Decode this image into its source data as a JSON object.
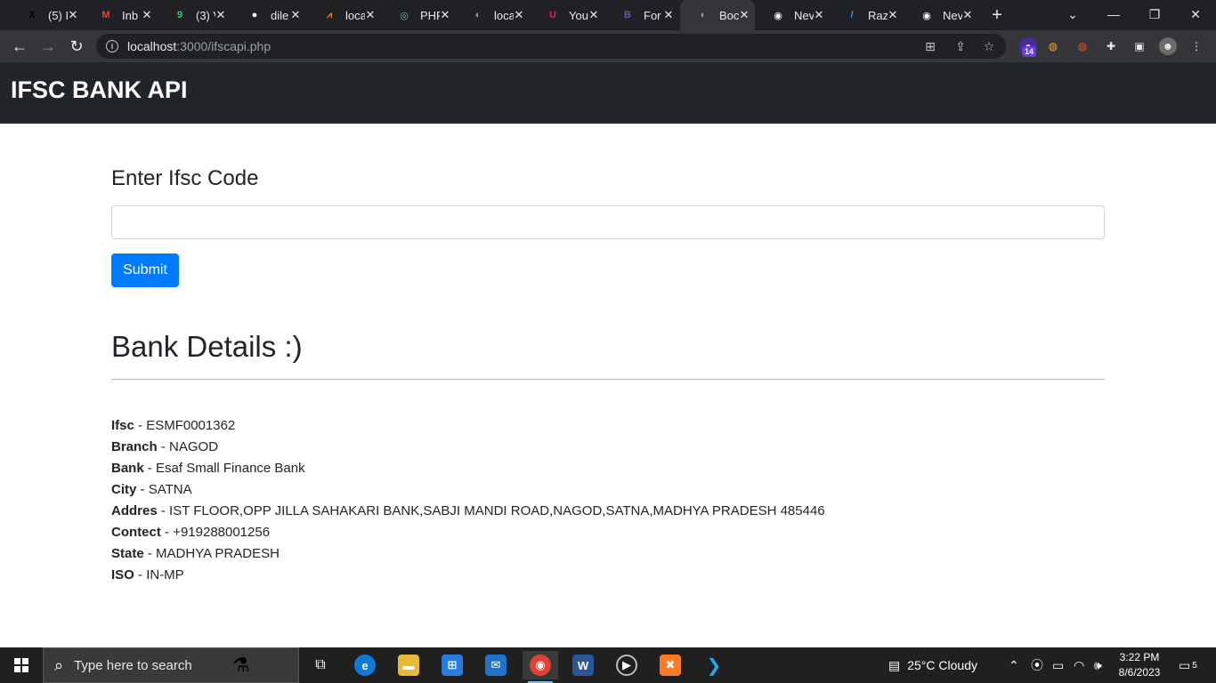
{
  "browser": {
    "tabs": [
      {
        "title": "(5) I",
        "icon": "x-icon",
        "icon_text": "X",
        "icon_color": "#000000"
      },
      {
        "title": "Inb",
        "icon": "gmail-icon",
        "icon_text": "M",
        "icon_color": "#ea4335"
      },
      {
        "title": "(3) V",
        "icon": "whatsapp-icon",
        "icon_text": "9",
        "icon_color": "#25d366"
      },
      {
        "title": "dile",
        "icon": "github-icon",
        "icon_text": "●",
        "icon_color": "#ffffff"
      },
      {
        "title": "loca",
        "icon": "xampp-icon",
        "icon_text": "⩘",
        "icon_color": "#fb7a24"
      },
      {
        "title": "PHF",
        "icon": "chatgpt-icon",
        "icon_text": "◎",
        "icon_color": "#74aa9c"
      },
      {
        "title": "loca",
        "icon": "globe-icon",
        "icon_text": "◐",
        "icon_color": "#9aa0a6"
      },
      {
        "title": "You",
        "icon": "udemy-icon",
        "icon_text": "U",
        "icon_color": "#ec1c5e"
      },
      {
        "title": "For",
        "icon": "bootstrap-icon",
        "icon_text": "B",
        "icon_color": "#7952b3"
      },
      {
        "title": "Boc",
        "icon": "globe-icon",
        "icon_text": "◐",
        "icon_color": "#9aa0a6"
      },
      {
        "title": "Nev",
        "icon": "chrome-icon",
        "icon_text": "◉",
        "icon_color": "#ffffff"
      },
      {
        "title": "Raz",
        "icon": "razorpay-icon",
        "icon_text": "/",
        "icon_color": "#3395ff"
      },
      {
        "title": "Nev",
        "icon": "chrome-icon",
        "icon_text": "◉",
        "icon_color": "#ffffff"
      }
    ],
    "active_tab": 9,
    "url_host": "localhost",
    "url_rest": ":3000/ifscapi.php",
    "extension_badge": "14"
  },
  "page": {
    "brand": "IFSC BANK API",
    "form": {
      "label": "Enter Ifsc Code",
      "input_value": "",
      "submit_label": "Submit"
    },
    "details_heading": "Bank Details :)",
    "details": [
      {
        "key": "Ifsc",
        "value": "ESMF0001362"
      },
      {
        "key": "Branch",
        "value": "NAGOD"
      },
      {
        "key": "Bank",
        "value": "Esaf Small Finance Bank"
      },
      {
        "key": "City",
        "value": "SATNA"
      },
      {
        "key": "Addres",
        "value": "IST FLOOR,OPP JILLA SAHAKARI BANK,SABJI MANDI ROAD,NAGOD,SATNA,MADHYA PRADESH 485446"
      },
      {
        "key": "Contect",
        "value": "+919288001256"
      },
      {
        "key": "State",
        "value": "MADHYA PRADESH"
      },
      {
        "key": "ISO",
        "value": "IN-MP"
      }
    ],
    "separator": " - "
  },
  "taskbar": {
    "search_placeholder": "Type here to search",
    "weather": "25°C  Cloudy",
    "time": "3:22 PM",
    "date": "8/6/2023",
    "notifications": "5"
  },
  "colors": {
    "navbar_bg": "#212529",
    "primary": "#007bff",
    "chrome_dark": "#202124",
    "chrome_toolbar": "#35363a"
  }
}
